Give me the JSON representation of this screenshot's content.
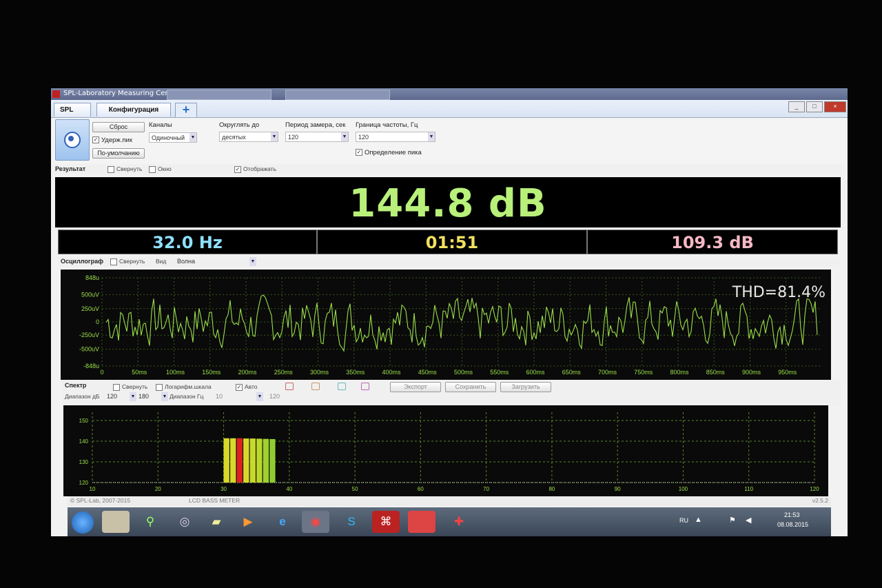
{
  "window": {
    "title": "SPL-Laboratory Measuring Center",
    "controls": [
      "_",
      "□",
      "×"
    ]
  },
  "tabs": [
    {
      "label": "SPL"
    },
    {
      "label": "Конфигурация"
    }
  ],
  "controls": {
    "reset_button": "Сброс",
    "hold_peak_label": "Удерж.пик",
    "default_button": "По-умолчанию",
    "channels_label": "Каналы",
    "channels_value": "Одиночный",
    "round_label": "Округлять до",
    "round_value": "десятых",
    "period_label": "Период замера, сек",
    "period_value": "120",
    "freq_limit_label": "Граница частоты, Гц",
    "freq_limit_value": "120",
    "peak_detect_label": "Определение пика"
  },
  "result_bar": {
    "title": "Результат",
    "collapse_label": "Свернуть",
    "window_label": "Окно",
    "display_label": "Отображать"
  },
  "readout": {
    "spl": "144.8 dB",
    "freq": "32.0 Hz",
    "time": "01:51",
    "avg": "109.3 dB"
  },
  "osc_bar": {
    "title": "Осциллограф",
    "collapse_label": "Свернуть",
    "view_label": "Вид",
    "view_value": "Волна"
  },
  "oscillograph": {
    "thd": "THD=81.4%",
    "y_ticks": [
      "848u",
      "500uV",
      "250uV",
      "0",
      "-250uV",
      "-500uV",
      "-848u"
    ],
    "x_ticks": [
      "0",
      "50ms",
      "100ms",
      "150ms",
      "200ms",
      "250ms",
      "300ms",
      "350ms",
      "400ms",
      "450ms",
      "500ms",
      "550ms",
      "600ms",
      "650ms",
      "700ms",
      "750ms",
      "800ms",
      "850ms",
      "900ms",
      "950ms"
    ]
  },
  "spectrum_bar": {
    "title": "Спектр",
    "collapse_label": "Свернуть",
    "log_label": "Логарифм.шкала",
    "auto_label": "Авто",
    "export_button": "Экспорт",
    "save_button": "Сохранить",
    "load_button": "Загрузить",
    "range_db_label": "Диапазон дБ",
    "range_db_min": "120",
    "range_db_max": "180",
    "range_hz_label": "Диапазон Гц",
    "range_hz_min": "10",
    "range_hz_max": "120"
  },
  "chart_data": {
    "type": "bar",
    "x_ticks": [
      "10",
      "20",
      "30",
      "40",
      "50",
      "60",
      "70",
      "80",
      "90",
      "100",
      "110",
      "120"
    ],
    "y_ticks": [
      "120",
      "130",
      "140",
      "150"
    ],
    "xlim": [
      10,
      120
    ],
    "ylim": [
      120,
      154
    ],
    "grid": true,
    "bars": [
      {
        "hz": 30,
        "db": 141.4,
        "color": "#d8d82a"
      },
      {
        "hz": 31,
        "db": 141.4,
        "color": "#d8d82a"
      },
      {
        "hz": 32,
        "db": 141.4,
        "color": "#e02020"
      },
      {
        "hz": 33,
        "db": 141.3,
        "color": "#d8d82a"
      },
      {
        "hz": 34,
        "db": 141.3,
        "color": "#c8d82a"
      },
      {
        "hz": 35,
        "db": 141.2,
        "color": "#b8d82a"
      },
      {
        "hz": 36,
        "db": 141.1,
        "color": "#a0d030"
      },
      {
        "hz": 37,
        "db": 141.0,
        "color": "#90cc30"
      }
    ]
  },
  "footer": {
    "copyright": "© SPL-Lab, 2007-2015",
    "product": "LCD BASS METER",
    "version": "v2.5.2"
  },
  "taskbar": {
    "lang": "RU",
    "time": "21:53",
    "date": "08.08.2015"
  }
}
